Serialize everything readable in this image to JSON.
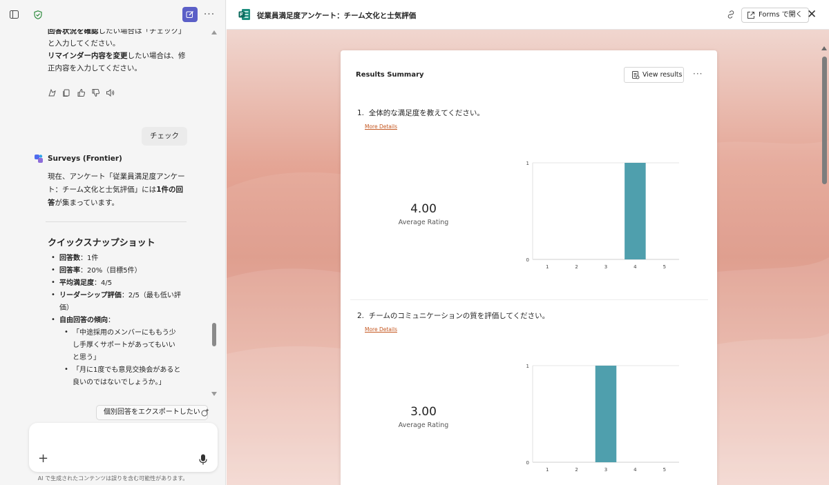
{
  "chat": {
    "intro_lines": [
      {
        "bold": "回答状況を確認",
        "rest": "したい場合は「チェック」"
      },
      {
        "bold": "",
        "rest": "と入力してください。"
      },
      {
        "bold": "リマインダー内容を変更",
        "rest": "したい場合は、修"
      },
      {
        "bold": "",
        "rest": "正内容を入力してください。"
      }
    ],
    "user_message": "チェック",
    "bot_name": "Surveys (Frontier)",
    "bot_lines": [
      {
        "pre": "現在、アンケート「従業員満足度アンケー",
        "bold": "",
        "post": ""
      },
      {
        "pre": "ト：チーム文化と士気評価」には",
        "bold": "1件の回",
        "post": ""
      },
      {
        "pre": "",
        "bold": "答",
        "post": "が集まっています。"
      }
    ],
    "snapshot_title": "クイックスナップショット",
    "bullets": [
      {
        "label": "回答数",
        "value": "：1件"
      },
      {
        "label": "回答率",
        "value": "：20%（目標5件）"
      },
      {
        "label": "平均満足度",
        "value": "：4/5"
      },
      {
        "label": "リーダーシップ評価",
        "value": "：2/5（最も低い評"
      },
      {
        "label": "",
        "value": "価）"
      },
      {
        "label": "自由回答の傾向",
        "value": "："
      }
    ],
    "sub_bullets": [
      [
        "「中途採用のメンバーにももう少",
        "し手厚くサポートがあってもいい",
        "と思う」"
      ],
      [
        "「月に1度でも意見交換会があると",
        "良いのではないでしょうか。」"
      ]
    ],
    "suggestion": "個別回答をエクスポートしたい",
    "composer_placeholder": "",
    "disclaimer": "AI で生成されたコンテンツは誤りを含む可能性があります。"
  },
  "forms": {
    "title": "従業員満足度アンケート：チーム文化と士気評価",
    "open_button": "Forms で開く",
    "summary_title": "Results Summary",
    "view_results": "View results",
    "more_details": "More Details",
    "avg_label": "Average Rating",
    "questions": [
      {
        "num": "1.",
        "text": "全体的な満足度を教えてください。",
        "avg": "4.00"
      },
      {
        "num": "2.",
        "text": "チームのコミュニケーションの質を評価してください。",
        "avg": "3.00"
      }
    ]
  },
  "chart_data": [
    {
      "type": "bar",
      "categories": [
        "1",
        "2",
        "3",
        "4",
        "5"
      ],
      "values": [
        0,
        0,
        0,
        1,
        0
      ],
      "ylim": [
        0,
        1
      ],
      "yticks": [
        "0",
        "1"
      ],
      "color": "#4f9fad"
    },
    {
      "type": "bar",
      "categories": [
        "1",
        "2",
        "3",
        "4",
        "5"
      ],
      "values": [
        0,
        0,
        1,
        0,
        0
      ],
      "ylim": [
        0,
        1
      ],
      "yticks": [
        "0",
        "1"
      ],
      "color": "#4f9fad"
    }
  ],
  "colors": {
    "accent": "#5b5fc7",
    "bar": "#4f9fad",
    "link": "#c4561f"
  }
}
